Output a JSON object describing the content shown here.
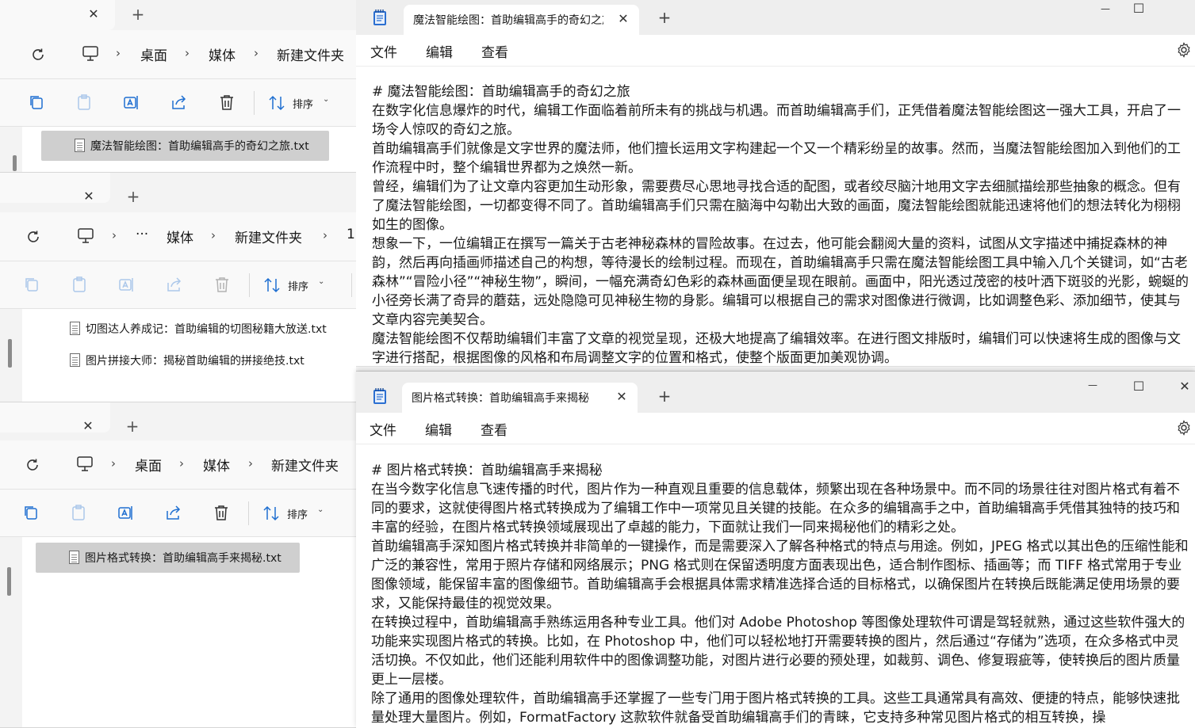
{
  "explorers": [
    {
      "tab_close": "✕",
      "tab_new": "+",
      "breadcrumbs": [
        "桌面",
        "媒体",
        "新建文件夹"
      ],
      "sort_label": "排序",
      "files": [
        "魔法智能绘图：首助编辑高手的奇幻之旅.txt"
      ]
    },
    {
      "tab_close": "✕",
      "tab_new": "+",
      "breadcrumbs": [
        "···",
        "媒体",
        "新建文件夹",
        "1"
      ],
      "sort_label": "排序",
      "files": [
        "切图达人养成记：首助编辑的切图秘籍大放送.txt",
        "图片拼接大师：揭秘首助编辑的拼接绝技.txt"
      ]
    },
    {
      "tab_close": "✕",
      "tab_new": "+",
      "breadcrumbs": [
        "桌面",
        "媒体",
        "新建文件夹"
      ],
      "sort_label": "排序",
      "files": [
        "图片格式转换：首助编辑高手来揭秘.txt"
      ]
    }
  ],
  "notepads": [
    {
      "tab_title": "魔法智能绘图：首助编辑高手的奇幻之旅",
      "menu": {
        "file": "文件",
        "edit": "编辑",
        "view": "查看"
      },
      "paragraphs": [
        "# 魔法智能绘图：首助编辑高手的奇幻之旅",
        "在数字化信息爆炸的时代，编辑工作面临着前所未有的挑战与机遇。而首助编辑高手们，正凭借着魔法智能绘图这一强大工具，开启了一场令人惊叹的奇幻之旅。",
        "首助编辑高手们就像是文字世界的魔法师，他们擅长运用文字构建起一个又一个精彩纷呈的故事。然而，当魔法智能绘图加入到他们的工作流程中时，整个编辑世界都为之焕然一新。",
        "曾经，编辑们为了让文章内容更加生动形象，需要费尽心思地寻找合适的配图，或者绞尽脑汁地用文字去细腻描绘那些抽象的概念。但有了魔法智能绘图，一切都变得不同了。首助编辑高手们只需在脑海中勾勒出大致的画面，魔法智能绘图就能迅速将他们的想法转化为栩栩如生的图像。",
        "想象一下，一位编辑正在撰写一篇关于古老神秘森林的冒险故事。在过去，他可能会翻阅大量的资料，试图从文字描述中捕捉森林的神韵，然后再向插画师描述自己的构想，等待漫长的绘制过程。而现在，首助编辑高手只需在魔法智能绘图工具中输入几个关键词，如“古老森林”“冒险小径”“神秘生物”，瞬间，一幅充满奇幻色彩的森林画面便呈现在眼前。画面中，阳光透过茂密的枝叶洒下斑驳的光影，蜿蜒的小径旁长满了奇异的蘑菇，远处隐隐可见神秘生物的身影。编辑可以根据自己的需求对图像进行微调，比如调整色彩、添加细节，使其与文章内容完美契合。",
        "魔法智能绘图不仅帮助编辑们丰富了文章的视觉呈现，还极大地提高了编辑效率。在进行图文排版时，编辑们可以快速将生成的图像与文字进行搭配，根据图像的风格和布局调整文字的位置和格式，使整个版面更加美观协调。"
      ]
    },
    {
      "tab_title": "图片格式转换：首助编辑高手来揭秘",
      "menu": {
        "file": "文件",
        "edit": "编辑",
        "view": "查看"
      },
      "paragraphs": [
        "# 图片格式转换：首助编辑高手来揭秘",
        "在当今数字化信息飞速传播的时代，图片作为一种直观且重要的信息载体，频繁出现在各种场景中。而不同的场景往往对图片格式有着不同的要求，这就使得图片格式转换成为了编辑工作中一项常见且关键的技能。在众多的编辑高手之中，首助编辑高手凭借其独特的技巧和丰富的经验，在图片格式转换领域展现出了卓越的能力，下面就让我们一同来揭秘他们的精彩之处。",
        "首助编辑高手深知图片格式转换并非简单的一键操作，而是需要深入了解各种格式的特点与用途。例如，JPEG 格式以其出色的压缩性能和广泛的兼容性，常用于照片存储和网络展示；PNG 格式则在保留透明度方面表现出色，适合制作图标、插画等；而 TIFF 格式常用于专业图像领域，能保留丰富的图像细节。首助编辑高手会根据具体需求精准选择合适的目标格式，以确保图片在转换后既能满足使用场景的要求，又能保持最佳的视觉效果。",
        "在转换过程中，首助编辑高手熟练运用各种专业工具。他们对 Adobe Photoshop 等图像处理软件可谓是驾轻就熟，通过这些软件强大的功能来实现图片格式的转换。比如，在 Photoshop 中，他们可以轻松地打开需要转换的图片，然后通过“存储为”选项，在众多格式中灵活切换。不仅如此，他们还能利用软件中的图像调整功能，对图片进行必要的预处理，如裁剪、调色、修复瑕疵等，使转换后的图片质量更上一层楼。",
        "除了通用的图像处理软件，首助编辑高手还掌握了一些专门用于图片格式转换的工具。这些工具通常具有高效、便捷的特点，能够快速批量处理大量图片。例如，FormatFactory 这款软件就备受首助编辑高手们的青睐，它支持多种常见图片格式的相互转换，操"
      ]
    }
  ],
  "window_controls": {
    "minimize": "—",
    "maximize": "☐",
    "close": "✕"
  }
}
